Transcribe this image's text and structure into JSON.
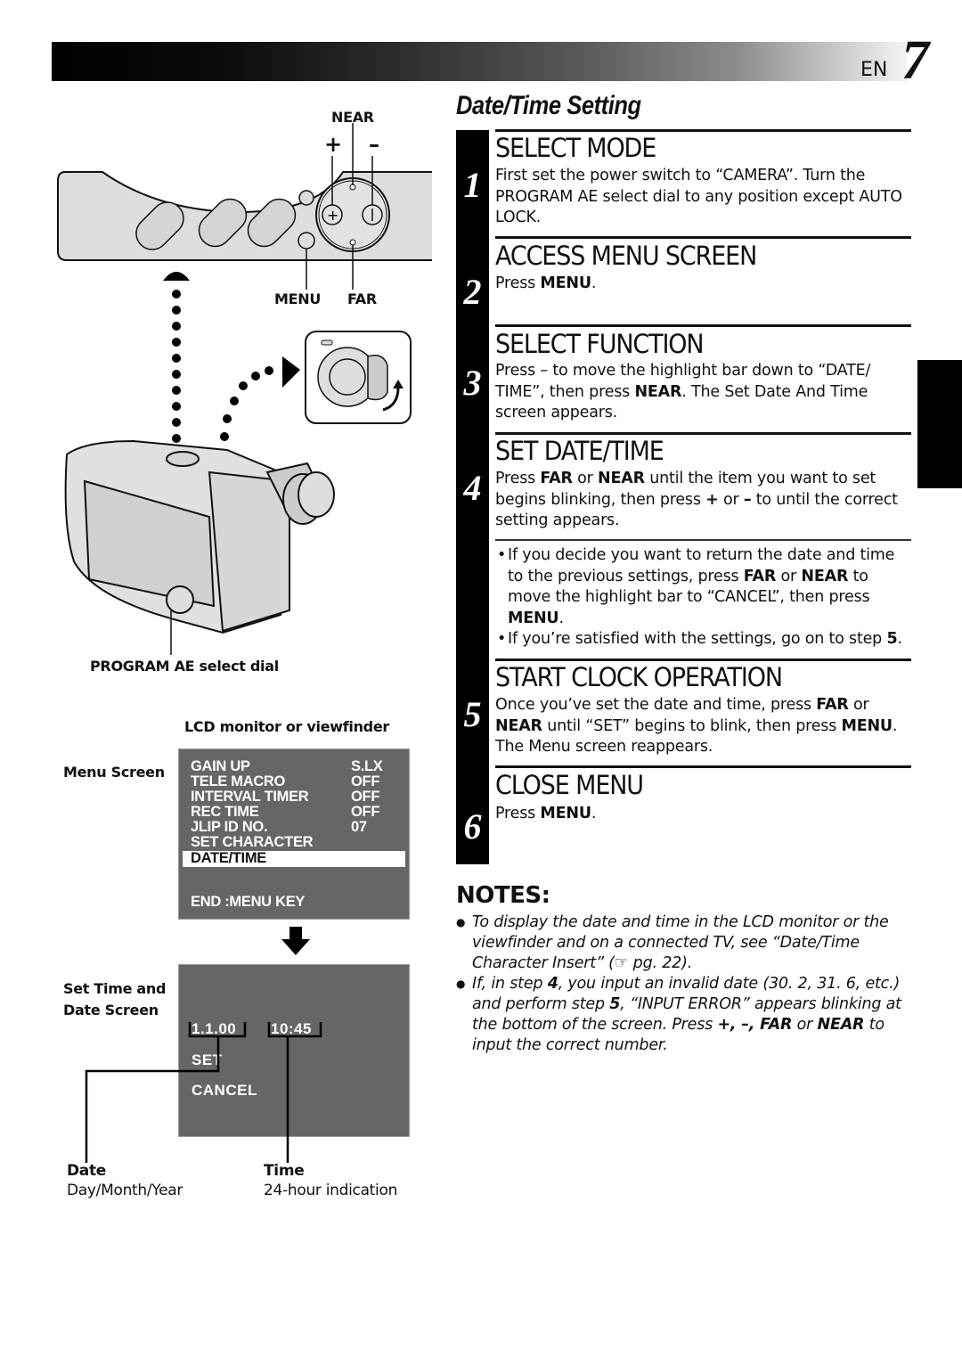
{
  "header": {
    "language": "EN",
    "page_number": "7"
  },
  "page_title": "Date/Time Setting",
  "figure": {
    "control_labels": {
      "near": "NEAR",
      "plus": "+",
      "minus": "–",
      "menu": "MENU",
      "far": "FAR"
    },
    "dial_label": "PROGRAM AE select dial",
    "lcd_label": "LCD monitor or viewfinder",
    "menu_screen_label": "Menu Screen",
    "menu_screen": {
      "rows": [
        {
          "item": "GAIN UP",
          "value": "S.LX"
        },
        {
          "item": "TELE MACRO",
          "value": "OFF"
        },
        {
          "item": "INTERVAL TIMER",
          "value": "OFF"
        },
        {
          "item": "REC TIME",
          "value": "OFF"
        },
        {
          "item": "JLIP ID NO.",
          "value": "07"
        },
        {
          "item": "SET CHARACTER",
          "value": ""
        }
      ],
      "highlighted": "DATE/TIME",
      "footer": "END :MENU KEY"
    },
    "datetime_screen_label_line1": "Set Time and",
    "datetime_screen_label_line2": "Date Screen",
    "datetime_screen": {
      "date": "1.1.00",
      "time": "10:45",
      "set": "SET",
      "cancel": "CANCEL"
    },
    "date_caption": {
      "title": "Date",
      "desc": "Day/Month/Year"
    },
    "time_caption": {
      "title": "Time",
      "desc": "24-hour indication"
    }
  },
  "steps": [
    {
      "num": "1",
      "title": "SELECT MODE",
      "body": [
        "First set the power switch to “CAMERA”. Turn the PROGRAM AE select dial to any position except AUTO LOCK."
      ]
    },
    {
      "num": "2",
      "title": "ACCESS MENU SCREEN",
      "body_pre": "Press ",
      "body_bold": "MENU",
      "body_post": "."
    },
    {
      "num": "3",
      "title": "SELECT FUNCTION",
      "body_pre": "Press – to move the highlight bar down to “DATE/ TIME”, then press ",
      "body_bold": "NEAR",
      "body_post": ". The Set Date And Time screen appears."
    },
    {
      "num": "4",
      "title": "SET DATE/TIME",
      "b1": "FAR",
      "t1": " or ",
      "b2": "NEAR",
      "t2": " until the item you want to set begins blinking, then press ",
      "b3": "+",
      "t3": " or ",
      "b4": "–",
      "t4": " to until the correct setting appears.",
      "pre": "Press ",
      "bullets": [
        {
          "t1": "If you decide you want to return the date and time to the previous settings, press ",
          "b1": "FAR",
          "t2": " or ",
          "b2": "NEAR",
          "t3": " to move the highlight bar to “CANCEL”, then press ",
          "b3": "MENU",
          "t4": "."
        },
        {
          "t1": "If you’re satisfied with the settings, go on to step ",
          "b1": "5",
          "t2": "."
        }
      ]
    },
    {
      "num": "5",
      "title": "START CLOCK OPERATION",
      "t1": "Once you’ve set the date and time, press ",
      "b1": "FAR",
      "t2": " or ",
      "b2": "NEAR",
      "t3": " until “SET” begins to blink, then press ",
      "b3": "MENU",
      "t4": ". The Menu screen reappears."
    },
    {
      "num": "6",
      "title": "CLOSE MENU",
      "body_pre": "Press ",
      "body_bold": "MENU",
      "body_post": "."
    }
  ],
  "notes": {
    "title": "NOTES:",
    "items": [
      {
        "text": "To display the date and time in the LCD monitor or the viewfinder and on a connected TV, see “Date/Time Character Insert” (☞ pg. 22)."
      },
      {
        "t1": "If, in step ",
        "b1": "4",
        "t2": ", you input an invalid date (30. 2, 31. 6, etc.) and perform step ",
        "b2": "5",
        "t3": ", “INPUT ERROR” appears blinking at the bottom of the screen. Press ",
        "b3": "+, –, FAR",
        "t4": " or ",
        "b4": "NEAR",
        "t5": " to input the correct number."
      }
    ]
  }
}
